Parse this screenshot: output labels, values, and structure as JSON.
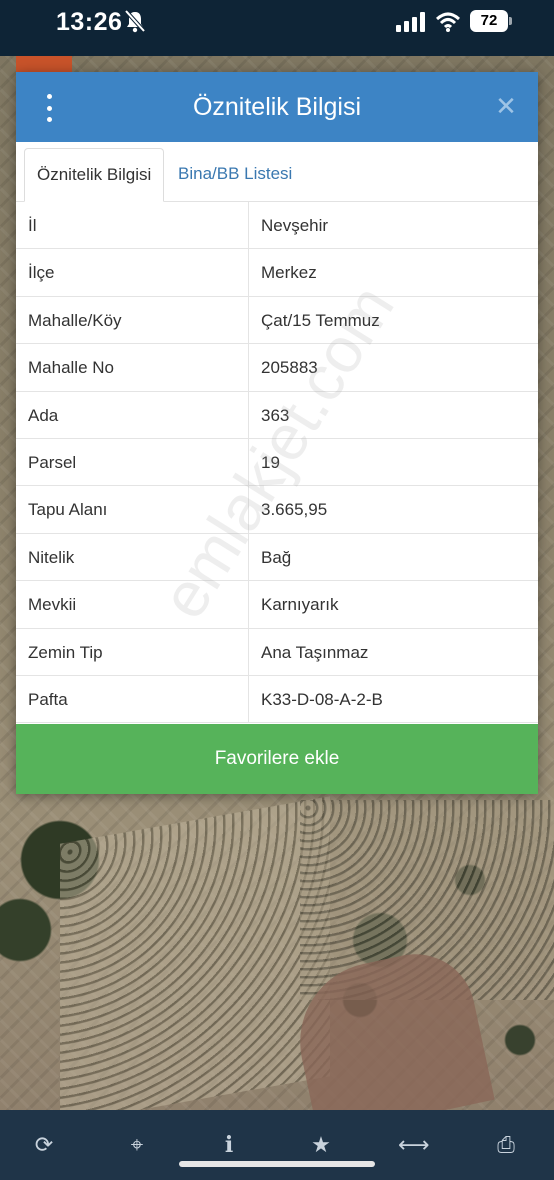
{
  "status_bar": {
    "time": "13:26",
    "battery": "72"
  },
  "modal": {
    "title": "Öznitelik Bilgisi",
    "close_symbol": "✕",
    "tabs": [
      {
        "label": "Öznitelik Bilgisi",
        "active": true
      },
      {
        "label": "Bina/BB Listesi",
        "active": false
      }
    ],
    "rows": [
      {
        "key": "İl",
        "value": "Nevşehir"
      },
      {
        "key": "İlçe",
        "value": "Merkez"
      },
      {
        "key": "Mahalle/Köy",
        "value": "Çat/15 Temmuz"
      },
      {
        "key": "Mahalle No",
        "value": "205883"
      },
      {
        "key": "Ada",
        "value": "363"
      },
      {
        "key": "Parsel",
        "value": "19"
      },
      {
        "key": "Tapu Alanı",
        "value": "3.665,95"
      },
      {
        "key": "Nitelik",
        "value": "Bağ"
      },
      {
        "key": "Mevkii",
        "value": "Karnıyarık"
      },
      {
        "key": "Zemin Tip",
        "value": "Ana Taşınmaz"
      },
      {
        "key": "Pafta",
        "value": "K33-D-08-A-2-B"
      }
    ],
    "favorite_button": "Favorilere ekle",
    "watermark": "emlakjet.com"
  },
  "toolbar": {
    "items": [
      {
        "icon": "refresh-icon",
        "glyph": "⟳"
      },
      {
        "icon": "locate-icon",
        "glyph": "⌖"
      },
      {
        "icon": "info-icon",
        "glyph": "i"
      },
      {
        "icon": "star-icon",
        "glyph": "★"
      },
      {
        "icon": "measure-icon",
        "glyph": "⟷"
      },
      {
        "icon": "print-icon",
        "glyph": "⎙"
      }
    ]
  }
}
